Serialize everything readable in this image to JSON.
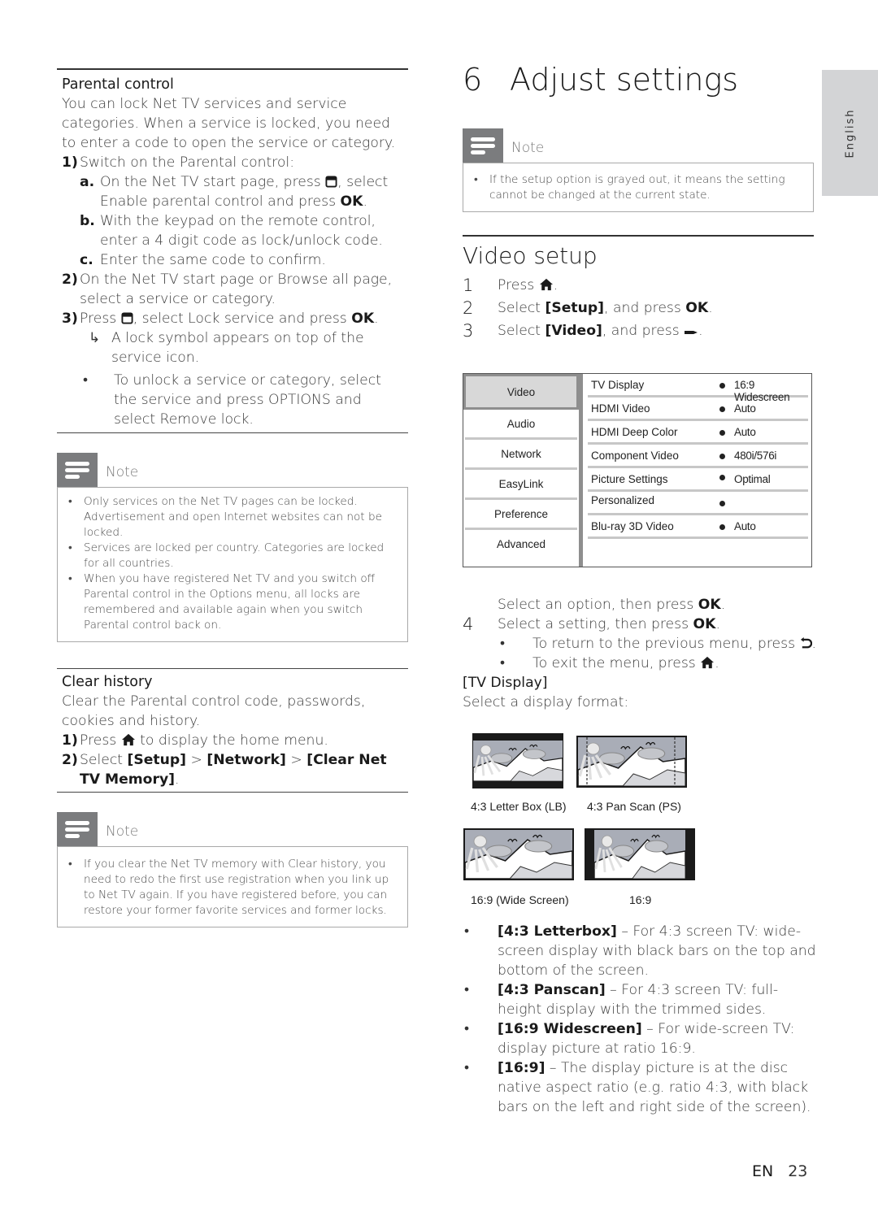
{
  "language_tab": "English",
  "left": {
    "parental": {
      "title": "Parental control",
      "intro": "You can lock Net TV services and service categories. When a service is locked, you need to enter a code to open the service or category.",
      "step1": {
        "num": "1)",
        "text": "Switch on the Parental control:"
      },
      "step1a": {
        "num": "a.",
        "pre": "On the Net TV start page, press",
        "icon": "options-icon",
        "mid": ", select Enable parental control and press ",
        "ok": "OK",
        "post": "."
      },
      "step1b": {
        "num": "b.",
        "text": "With the keypad on the remote control, enter a 4 digit code as lock/unlock code."
      },
      "step1c": {
        "num": "c.",
        "text": "Enter the same code to confirm."
      },
      "step2": {
        "num": "2)",
        "text": "On the Net TV start page or Browse all page, select a service or category."
      },
      "step3": {
        "num": "3)",
        "pre": "Press",
        "mid": ", select Lock service and press ",
        "ok": "OK",
        "post": "."
      },
      "result": {
        "arrow": "↳",
        "text": "A lock symbol appears on top of the service icon."
      },
      "bullet": {
        "bul": "•",
        "text": "To unlock a service or category, select the service and press OPTIONS and select Remove lock."
      }
    },
    "note1": {
      "title": "Note",
      "items": [
        "Only services on the Net TV pages can be locked. Advertisement and open Internet websites can not be locked.",
        "Services are locked per country. Categories are locked for all countries.",
        "When you have registered Net TV and you switch off Parental control in the Options menu, all locks are remembered and available again when you switch Parental control back on."
      ]
    },
    "clear": {
      "title": "Clear history",
      "intro": "Clear the Parental control code, passwords, cookies and history.",
      "step1": {
        "num": "1)",
        "pre": "Press",
        "post": "to display the home menu."
      },
      "step2": {
        "num": "2)",
        "pre": "Select ",
        "setup": "[Setup]",
        "gt1": " > ",
        "network": "[Network]",
        "gt2": " > ",
        "clear": "[Clear Net TV Memory]",
        "post": "."
      }
    },
    "note2": {
      "title": "Note",
      "items": [
        "If you clear the Net TV memory with Clear history, you need to redo the first use registration when you link up to Net TV again. If you have registered before, you can restore your former favorite services and former locks."
      ]
    }
  },
  "right": {
    "chapter_num": "6",
    "chapter_title": "Adjust settings",
    "note": {
      "title": "Note",
      "items": [
        "If the setup option is grayed out, it means the setting cannot be changed at the current state."
      ]
    },
    "section_title": "Video setup",
    "steps": [
      {
        "num": "1",
        "pre": "Press",
        "post": "."
      },
      {
        "num": "2",
        "pre": "Select ",
        "bold": "[Setup]",
        "mid": ", and press ",
        "ok": "OK",
        "post": "."
      },
      {
        "num": "3",
        "pre": "Select ",
        "bold": "[Video]",
        "mid": ", and press",
        "post": "."
      }
    ],
    "menu": {
      "tabs": [
        "Video",
        "Audio",
        "Network",
        "EasyLink",
        "Preference",
        "Advanced"
      ],
      "active_tab": "Video",
      "rows": [
        {
          "label": "TV Display",
          "value": "16:9 Widescreen"
        },
        {
          "label": "HDMI Video",
          "value": "Auto"
        },
        {
          "label": "HDMI Deep Color",
          "value": "Auto"
        },
        {
          "label": "Component Video",
          "value": "480i/576i"
        },
        {
          "label": "Picture Settings",
          "value": "Optimal"
        },
        {
          "label": "Personalized",
          "value": ""
        },
        {
          "label": "Blu-ray 3D Video",
          "value": "Auto"
        }
      ]
    },
    "after_menu": {
      "pre": "Select an option, then press ",
      "ok": "OK",
      "post": "."
    },
    "step4": {
      "num": "4",
      "pre": "Select a setting, then press ",
      "ok": "OK",
      "post": "."
    },
    "step4_bullets": [
      {
        "pre": "To return to the previous menu, press",
        "icon": "back-icon",
        "post": "."
      },
      {
        "pre": "To exit the menu, press",
        "icon": "home-icon",
        "post": "."
      }
    ],
    "tv_display": {
      "title": "[TV Display]",
      "intro": "Select a display format:"
    },
    "formats": [
      {
        "caption": "4:3 Letter Box (LB)",
        "kind": "letterbox"
      },
      {
        "caption": "4:3 Pan Scan (PS)",
        "kind": "panscan"
      },
      {
        "caption": "16:9 (Wide Screen)",
        "kind": "widescreen"
      },
      {
        "caption": "16:9",
        "kind": "pillarbox"
      }
    ],
    "format_desc": [
      {
        "bold": "[4:3 Letterbox]",
        "text": " – For 4:3 screen TV: wide-screen display with black bars on the top and bottom of the screen."
      },
      {
        "bold": "[4:3 Panscan]",
        "text": " – For 4:3 screen TV: full-height display with the trimmed sides."
      },
      {
        "bold": "[16:9 Widescreen]",
        "text": " – For wide-screen TV: display picture at ratio 16:9."
      },
      {
        "bold": "[16:9]",
        "text": " – The display picture is at the disc native aspect ratio (e.g. ratio 4:3, with black bars on the left and right side of the screen)."
      }
    ]
  },
  "footer": {
    "lang": "EN",
    "page": "23"
  }
}
